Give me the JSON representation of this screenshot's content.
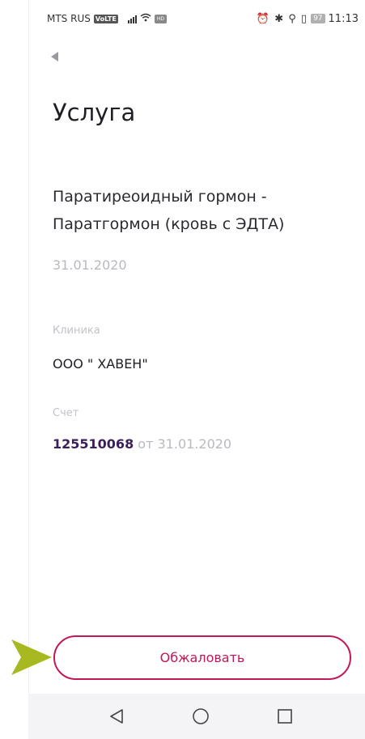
{
  "status_bar": {
    "carrier": "MTS RUS",
    "volte": "VoLTE",
    "sim2": "HD",
    "battery": "97",
    "icons": "⏰ ✱ ⚲ ▯",
    "time": "11:13"
  },
  "header": {
    "back_icon": "back-triangle-icon",
    "title": "Услуга"
  },
  "service": {
    "name": "Паратиреоидный гормон - Паратгормон (кровь с ЭДТА)",
    "date": "31.01.2020"
  },
  "clinic": {
    "label": "Клиника",
    "value": "ООО \" ХАВЕН\""
  },
  "account": {
    "label": "Счет",
    "number": "125510068",
    "separator": "от",
    "date": "31.01.2020"
  },
  "actions": {
    "appeal_label": "Обжаловать"
  },
  "colors": {
    "accent": "#c2185b",
    "account_number": "#3a1f5a",
    "muted": "#b9b9c0",
    "pointer_arrow": "#a8b820"
  },
  "nav_bar": {
    "back": "nav-back-icon",
    "home": "nav-home-icon",
    "recents": "nav-recents-icon"
  }
}
